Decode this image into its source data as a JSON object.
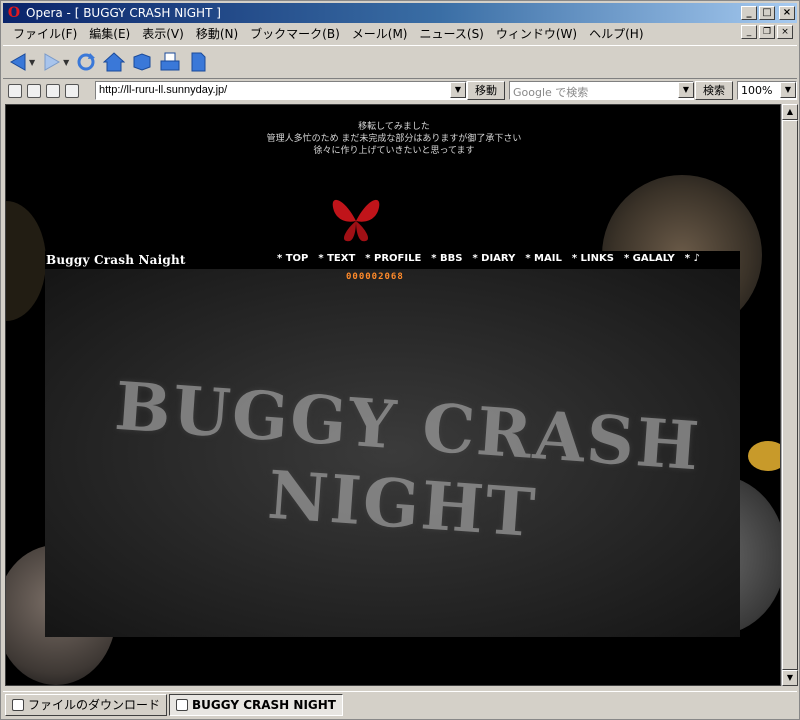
{
  "window": {
    "title": "Opera - [ BUGGY CRASH NIGHT ]",
    "controls": [
      "_",
      "□",
      "×"
    ]
  },
  "menu": {
    "items": [
      "ファイル(F)",
      "編集(E)",
      "表示(V)",
      "移動(N)",
      "ブックマーク(B)",
      "メール(M)",
      "ニュース(S)",
      "ウィンドウ(W)",
      "ヘルプ(H)"
    ]
  },
  "address": {
    "url": "http://ll-ruru-ll.sunnyday.jp/",
    "go_label": "移動",
    "search_placeholder": "Google で検索",
    "search_label": "検索",
    "zoom": "100%"
  },
  "page": {
    "notice": [
      "移転してみました",
      "管理人多忙のため まだ未完成な部分はありますが御了承下さい",
      "徐々に作り上げていきたいと思ってます"
    ],
    "site_title": "Buggy Crash Naight",
    "nav": [
      "* TOP",
      "* TEXT",
      "* PROFILE",
      "* BBS",
      "* DIARY",
      "* MAIL",
      "* LINKS",
      "* GALALY",
      "* ♪"
    ],
    "counter": "000002068",
    "banner_text": "BUGGY CRASH NIGHT"
  },
  "statusbar": {
    "download_label": "ファイルのダウンロード",
    "tab_label": "BUGGY CRASH NIGHT"
  }
}
